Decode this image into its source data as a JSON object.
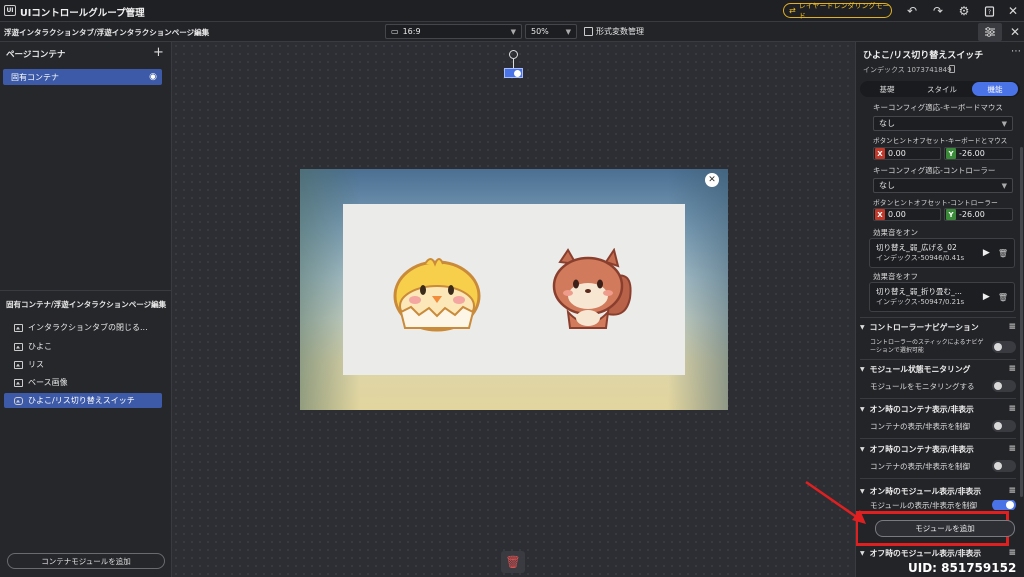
{
  "app": {
    "title": "UIコントロールグループ管理",
    "layer_mode_label": "レイヤードレンダリングモード"
  },
  "subbar": {
    "breadcrumb": "浮遊インタラクションタブ/浮遊インタラクションページ編集",
    "aspect_ratio": "16:9",
    "zoom": "50%",
    "format_vars_label": "形式変数管理"
  },
  "left": {
    "page_container_title": "ページコンテナ",
    "fixed_container_label": "固有コンテナ",
    "edit_title": "固有コンテナ/浮遊インタラクションページ編集",
    "tree": [
      {
        "label": "インタラクションタブの閉じる..."
      },
      {
        "label": "ひよこ"
      },
      {
        "label": "リス"
      },
      {
        "label": "ベース画像"
      },
      {
        "label": "ひよこ/リス切り替えスイッチ"
      }
    ],
    "add_module_label": "コンテナモジュールを追加"
  },
  "right": {
    "title": "ひよこ/リス切り替えスイッチ",
    "index_text": "インデックス 1073741849",
    "tabs": [
      "基礎",
      "スタイル",
      "機能"
    ],
    "keyconfig_kbm_label": "キーコンフィグ適応-キーボードマウス",
    "keyconfig_kbm_value": "なし",
    "btnhint_kbm_label": "ボタンヒントオフセット-キーボードとマウス",
    "kbm_x": "0.00",
    "kbm_y": "-26.00",
    "keyconfig_ctrl_label": "キーコンフィグ適応-コントローラー",
    "keyconfig_ctrl_value": "なし",
    "btnhint_ctrl_label": "ボタンヒントオフセット-コントローラー",
    "ctrl_x": "0.00",
    "ctrl_y": "-26.00",
    "sound_on_label": "効果音をオン",
    "sound_on_name": "切り替え_弱_広げる_02",
    "sound_on_index": "インデックス-50946/0.41s",
    "sound_off_label": "効果音をオフ",
    "sound_off_name": "切り替え_弱_折り畳む_...",
    "sound_off_index": "インデックス-50947/0.21s",
    "sections": [
      {
        "title": "コントローラーナビゲーション",
        "row": "コントローラーのスティックによるナビゲーションで選択可能"
      },
      {
        "title": "モジュール状態モニタリング",
        "row": "モジュールをモニタリングする"
      },
      {
        "title": "オン時のコンテナ表示/非表示",
        "row": "コンテナの表示/非表示を制御"
      },
      {
        "title": "オフ時のコンテナ表示/非表示",
        "row": "コンテナの表示/非表示を制御"
      },
      {
        "title": "オン時のモジュール表示/非表示",
        "row": "モジュールの表示/非表示を制御"
      },
      {
        "title": "オフ時のモジュール表示/非表示"
      }
    ],
    "add_module_label": "モジュールを追加",
    "axis_x": "X",
    "axis_y": "Y"
  },
  "uid": "UID: 851759152",
  "colors": {
    "accent": "#4a73e8",
    "highlight": "#e02020",
    "selected": "#3d5aa8",
    "layer_badge": "#e0b020"
  }
}
